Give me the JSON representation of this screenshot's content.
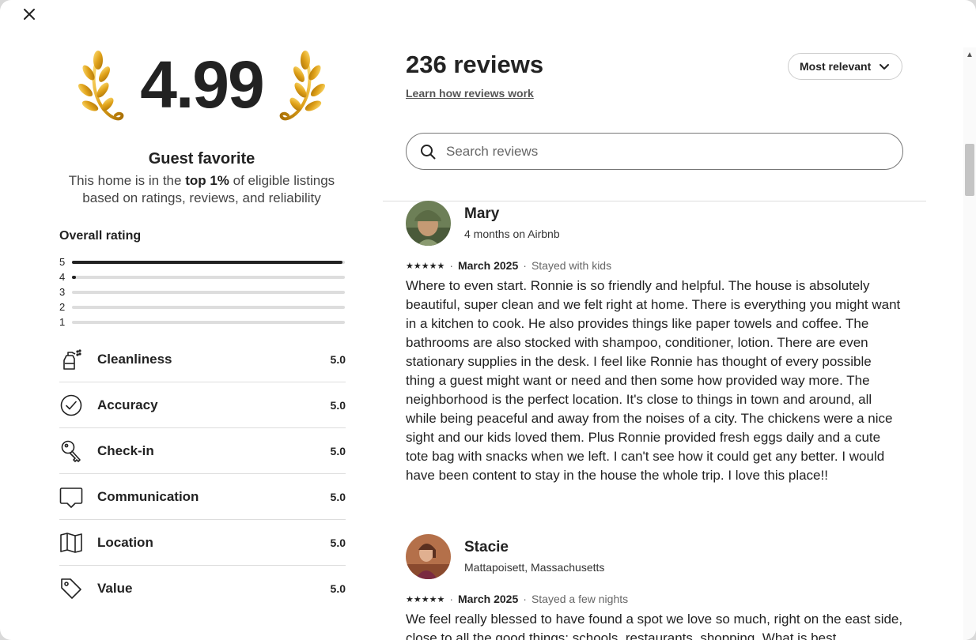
{
  "rating": {
    "score": "4.99",
    "badge_title": "Guest favorite",
    "badge_sub_prefix": "This home is in the ",
    "badge_sub_bold": "top 1%",
    "badge_sub_suffix": " of eligible listings based on ratings, reviews, and reliability"
  },
  "overall": {
    "title": "Overall rating",
    "bars": [
      {
        "label": "5",
        "fill": 0.99
      },
      {
        "label": "4",
        "fill": 0.01
      },
      {
        "label": "3",
        "fill": 0
      },
      {
        "label": "2",
        "fill": 0
      },
      {
        "label": "1",
        "fill": 0
      }
    ]
  },
  "categories": [
    {
      "label": "Cleanliness",
      "score": "5.0",
      "icon": "spray-bottle-icon"
    },
    {
      "label": "Accuracy",
      "score": "5.0",
      "icon": "check-circle-icon"
    },
    {
      "label": "Check-in",
      "score": "5.0",
      "icon": "key-icon"
    },
    {
      "label": "Communication",
      "score": "5.0",
      "icon": "chat-bubble-icon"
    },
    {
      "label": "Location",
      "score": "5.0",
      "icon": "map-icon"
    },
    {
      "label": "Value",
      "score": "5.0",
      "icon": "tag-icon"
    }
  ],
  "reviews_header": {
    "count": "236 reviews",
    "learn_link": "Learn how reviews work",
    "sort_label": "Most relevant",
    "search_placeholder": "Search reviews"
  },
  "reviews": [
    {
      "name": "Mary",
      "meta": "4 months on Airbnb",
      "stars": "★★★★★",
      "date": "March 2025",
      "stay": "Stayed with kids",
      "text": "Where to even start. Ronnie is so friendly and helpful. The house is absolutely beautiful, super clean and we felt right at home. There is everything you might want in a kitchen to cook. He also provides things like paper towels and coffee. The bathrooms are also stocked with shampoo, conditioner, lotion. There are even stationary supplies in the desk. I feel like Ronnie has thought of every possible thing a guest might want or need and then some how provided way more. The neighborhood is  the perfect location. It's close to things in town and around, all while being peaceful and away from the noises of a city. The chickens were a nice sight and our kids loved them. Plus Ronnie provided fresh eggs daily and a cute tote bag with snacks when we left. I can't see how it could get any better. I  would have been content to stay in the house the whole trip. I love this place!!"
    },
    {
      "name": "Stacie",
      "meta": "Mattapoisett, Massachusetts",
      "stars": "★★★★★",
      "date": "March 2025",
      "stay": "Stayed a few nights",
      "text": "We feel really blessed to have found a spot we love so much, right on the east side, close to all the good things: schools, restaurants, shopping. What is best"
    }
  ],
  "colors": {
    "laurel_gold": "#e0a21a",
    "text_dark": "#222222",
    "bar_track": "#dddddd"
  }
}
